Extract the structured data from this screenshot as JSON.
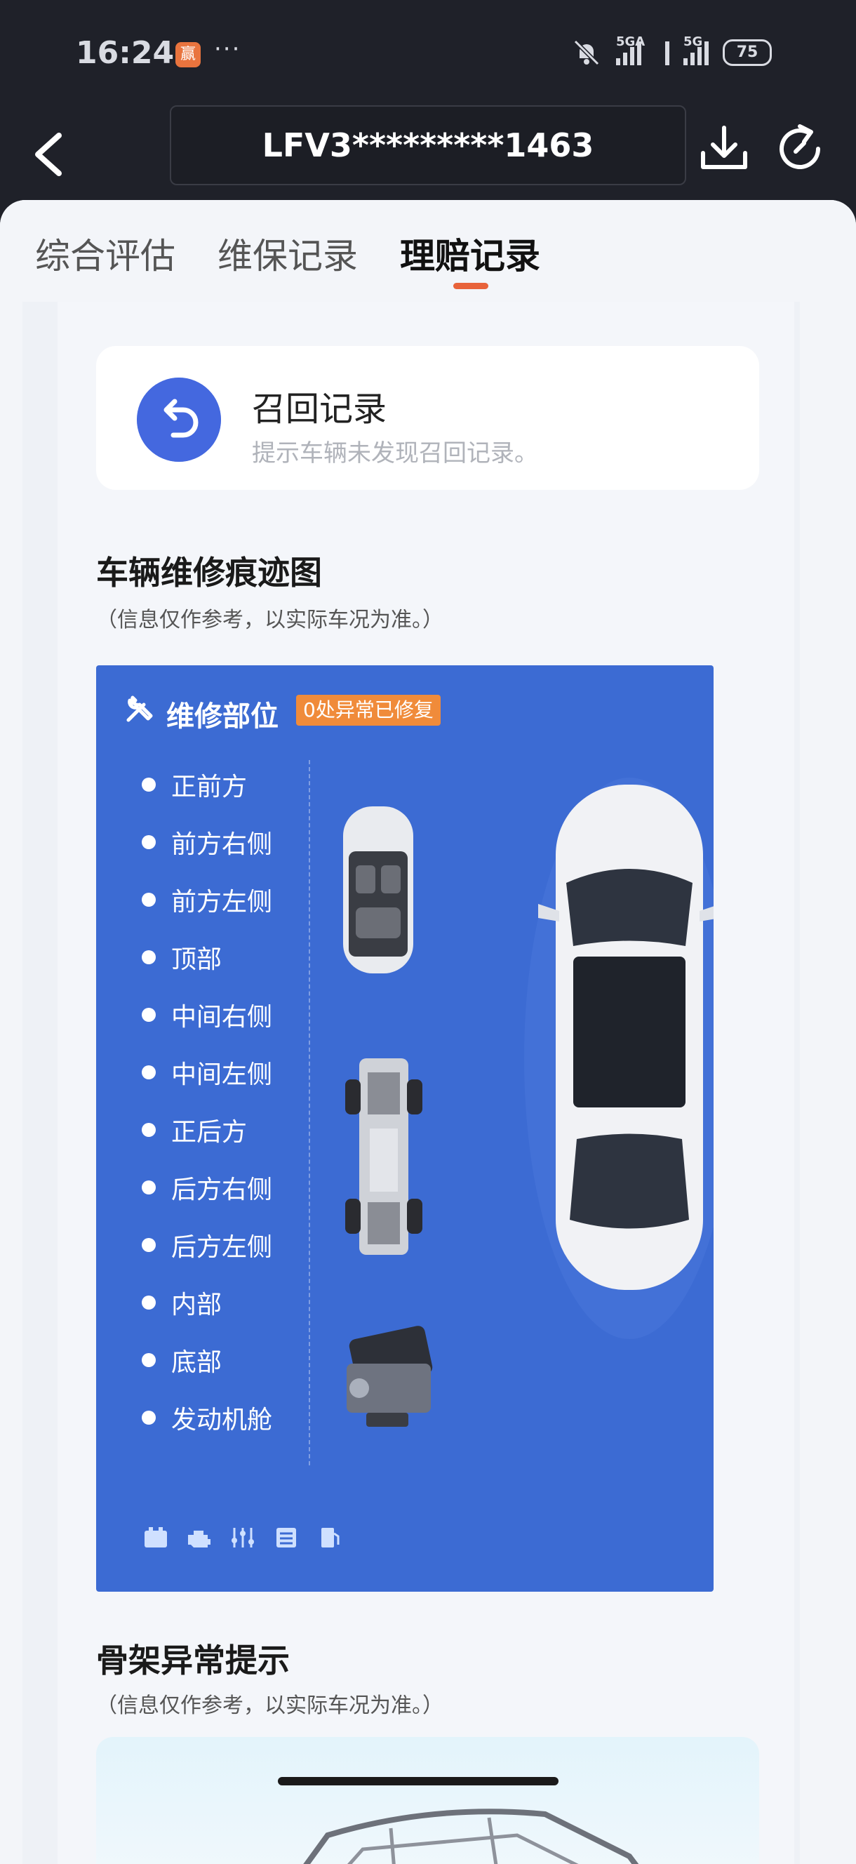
{
  "status_bar": {
    "time": "16:24",
    "app_badge": "赢",
    "more": "···",
    "network_1": "5GA",
    "network_2": "5G",
    "battery": "75"
  },
  "nav": {
    "vin": "LFV3*********1463"
  },
  "tabs": [
    {
      "label": "综合评估",
      "active": false
    },
    {
      "label": "维保记录",
      "active": false
    },
    {
      "label": "理赔记录",
      "active": true
    }
  ],
  "recall": {
    "title": "召回记录",
    "desc": "提示车辆未发现召回记录。"
  },
  "repair_section": {
    "title": "车辆维修痕迹图",
    "subtitle": "（信息仅作参考，以实际车况为准。）",
    "card_title": "维修部位",
    "badge": "0处异常已修复",
    "parts": [
      "正前方",
      "前方右侧",
      "前方左侧",
      "顶部",
      "中间右侧",
      "中间左侧",
      "正后方",
      "后方右侧",
      "后方左侧",
      "内部",
      "底部",
      "发动机舱"
    ]
  },
  "skeleton_section": {
    "title": "骨架异常提示",
    "subtitle": "（信息仅作参考，以实际车况为准。）"
  },
  "colors": {
    "accent": "#e8633b",
    "card_blue": "#3c6bd3",
    "badge_orange": "#f08b3a"
  }
}
